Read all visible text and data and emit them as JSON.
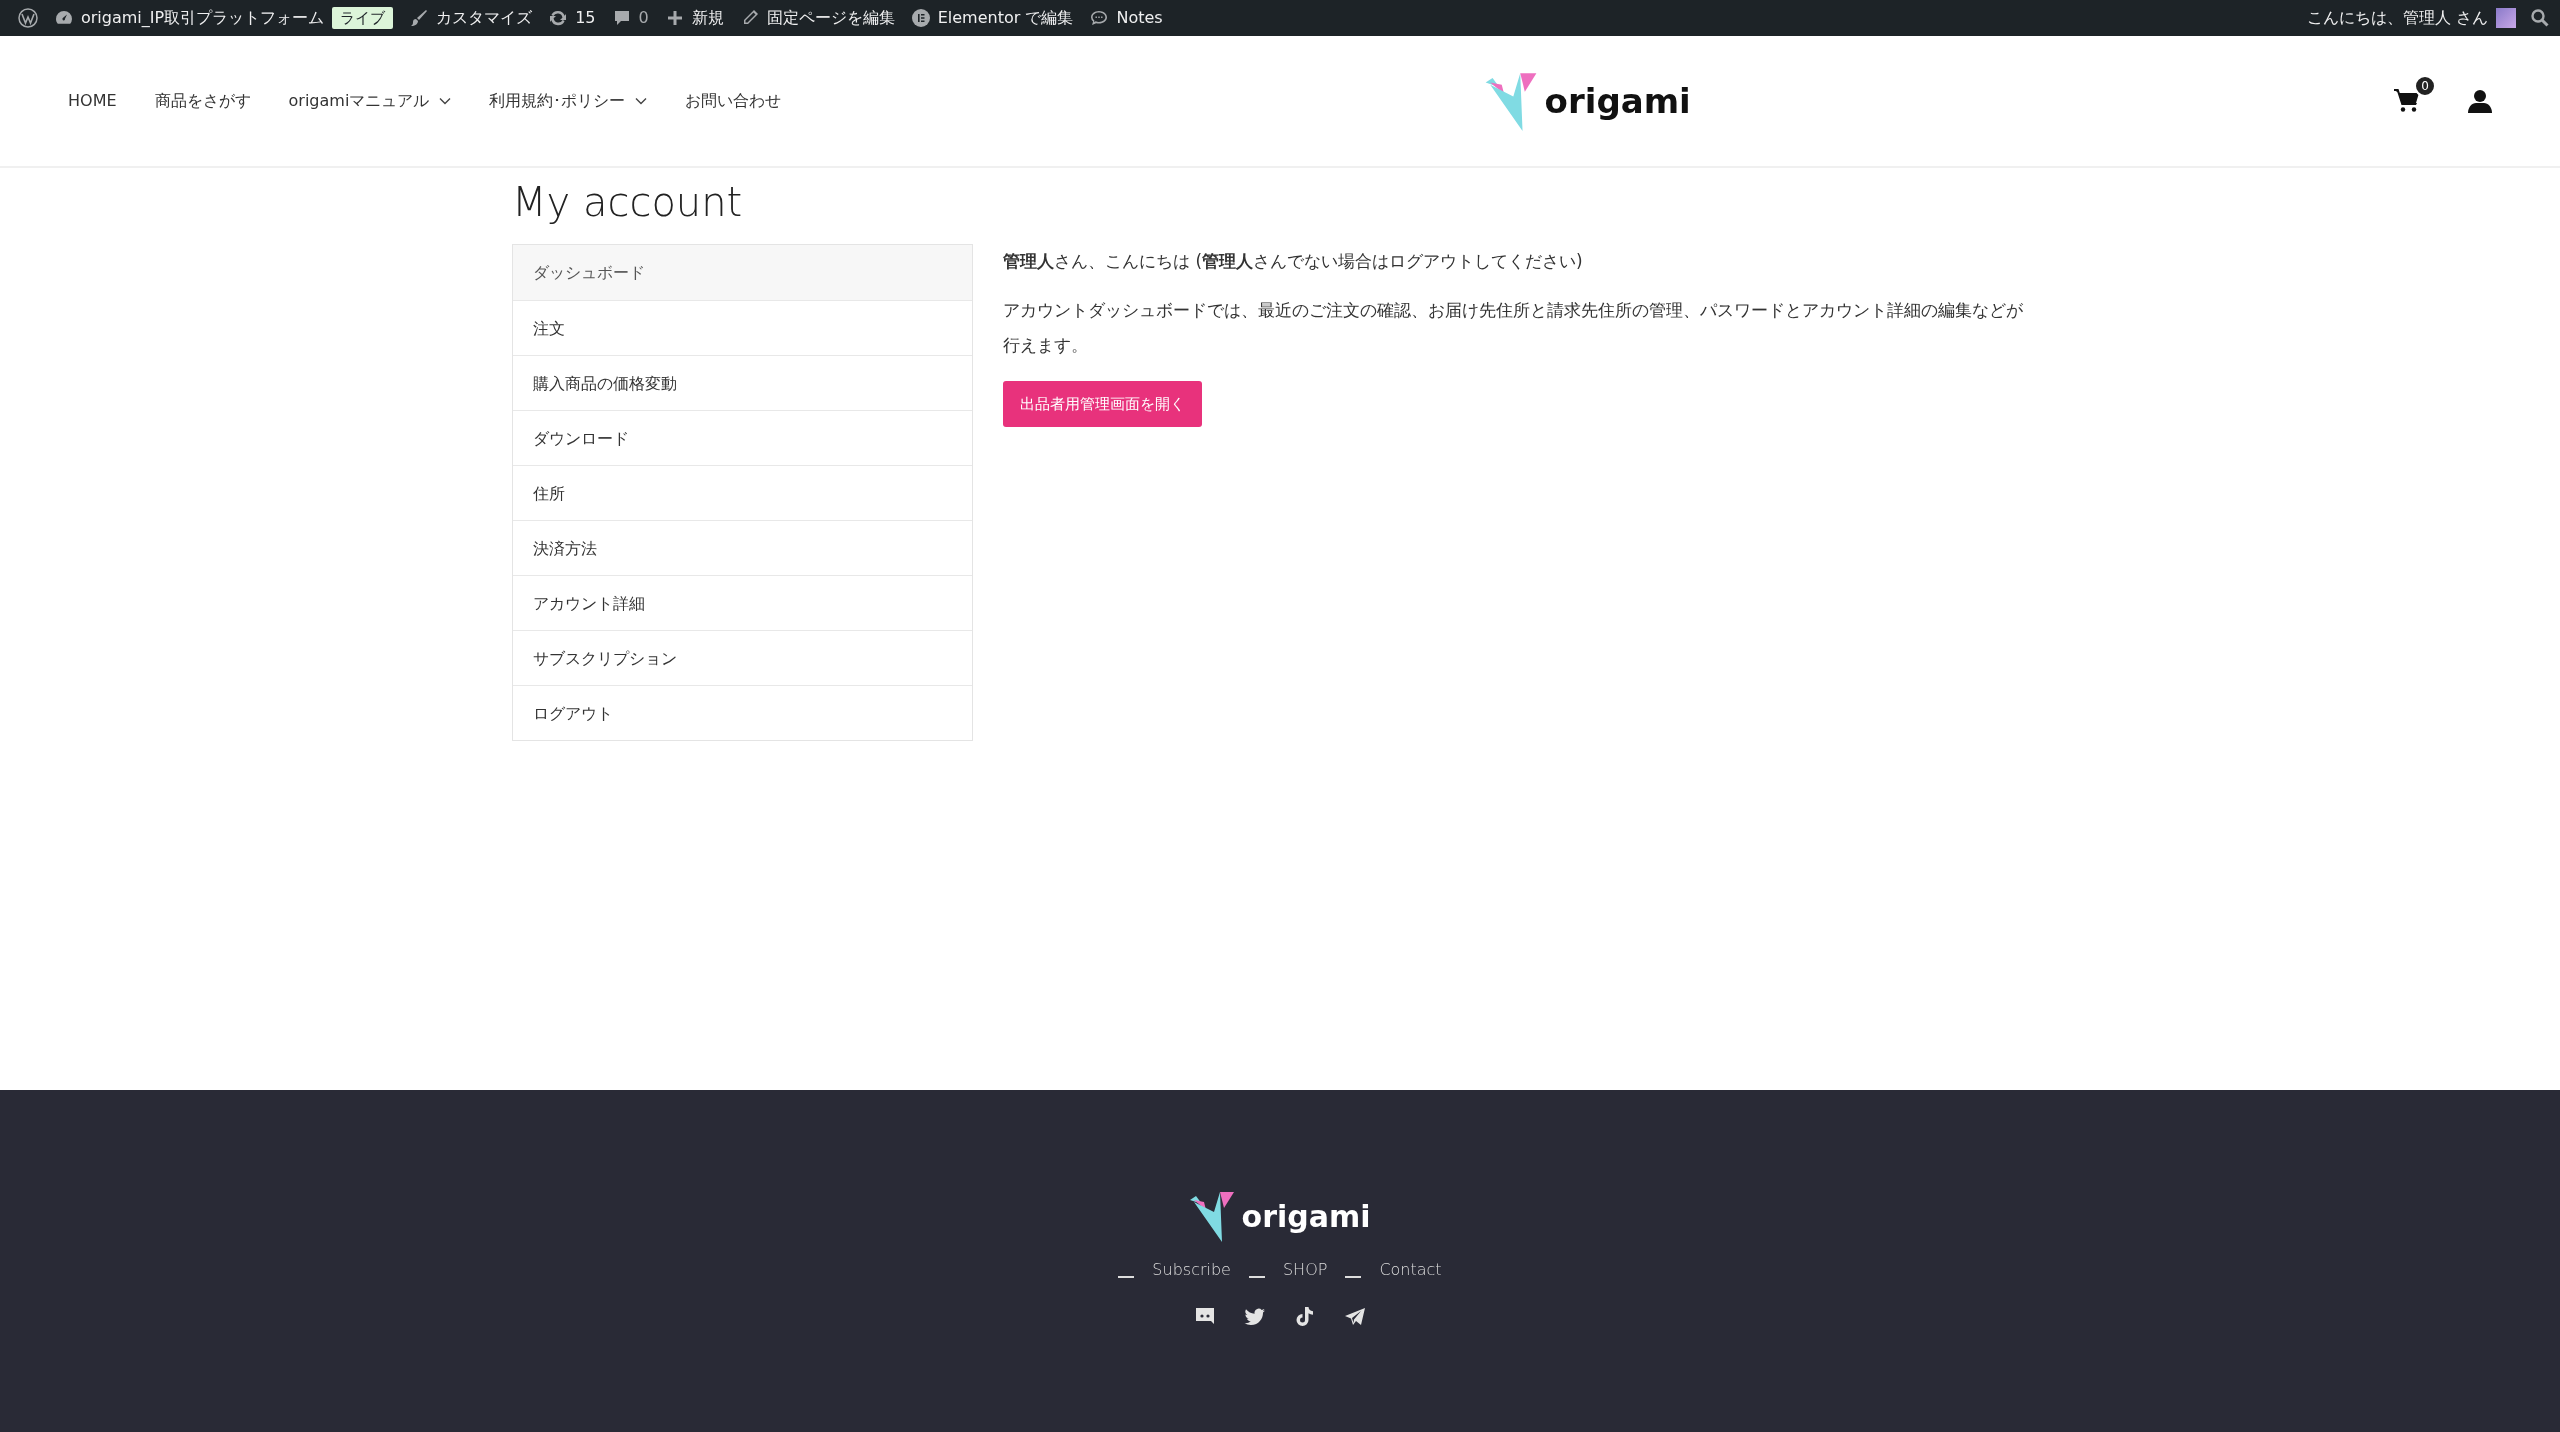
{
  "admin_bar": {
    "items": [
      {
        "kind": "wp"
      },
      {
        "kind": "site",
        "label": "origami_IP取引プラットフォーム"
      },
      {
        "kind": "badge",
        "label": "ライブ"
      },
      {
        "kind": "customize",
        "label": "カスタマイズ"
      },
      {
        "kind": "updates",
        "label": "15"
      },
      {
        "kind": "comments",
        "label": "0"
      },
      {
        "kind": "new",
        "label": "新規"
      },
      {
        "kind": "edit",
        "label": "固定ページを編集"
      },
      {
        "kind": "elementor",
        "label": "Elementor で編集"
      },
      {
        "kind": "notes",
        "label": "Notes"
      }
    ],
    "greeting": "こんにちは、管理人 さん"
  },
  "header": {
    "nav": [
      {
        "label": "HOME",
        "dropdown": false
      },
      {
        "label": "商品をさがす",
        "dropdown": false
      },
      {
        "label": "origamiマニュアル",
        "dropdown": true
      },
      {
        "label": "利用規約･ポリシー",
        "dropdown": true
      },
      {
        "label": "お問い合わせ",
        "dropdown": false
      }
    ],
    "logo": "origami",
    "cart_count": "0"
  },
  "page_title": "My account",
  "account_menu": [
    {
      "label": "ダッシュボード",
      "selected": true
    },
    {
      "label": "注文",
      "selected": false
    },
    {
      "label": "購入商品の価格変動",
      "selected": false
    },
    {
      "label": "ダウンロード",
      "selected": false
    },
    {
      "label": "住所",
      "selected": false
    },
    {
      "label": "決済方法",
      "selected": false
    },
    {
      "label": "アカウント詳細",
      "selected": false
    },
    {
      "label": "サブスクリプション",
      "selected": false
    },
    {
      "label": "ログアウト",
      "selected": false
    }
  ],
  "paragraphs": [
    [
      {
        "kind": "text",
        "text": "**管理人**さん、こんにちは (**管理人**さんでない場合は"
      },
      {
        "kind": "link",
        "text": "ログアウト"
      },
      {
        "kind": "text",
        "text": "してください)"
      }
    ],
    [
      {
        "kind": "text",
        "text": "アカウントダッシュボードでは、"
      },
      {
        "kind": "link",
        "text": "最近のご注文"
      },
      {
        "kind": "text",
        "text": "の確認、"
      },
      {
        "kind": "link",
        "text": "お届け先住所と請求先住所の管理"
      },
      {
        "kind": "text",
        "text": "、"
      },
      {
        "kind": "link",
        "text": "パスワードとアカウント詳細の編集"
      },
      {
        "kind": "text",
        "text": "などが行えます。"
      }
    ]
  ],
  "vendor_button": "出品者用管理画面を開く",
  "footer": {
    "logo": "origami",
    "links": [
      "Subscribe",
      "SHOP",
      "Contact"
    ],
    "social": [
      {
        "kind": "discord"
      },
      {
        "kind": "twitter"
      },
      {
        "kind": "tiktok"
      },
      {
        "kind": "telegram"
      }
    ]
  }
}
